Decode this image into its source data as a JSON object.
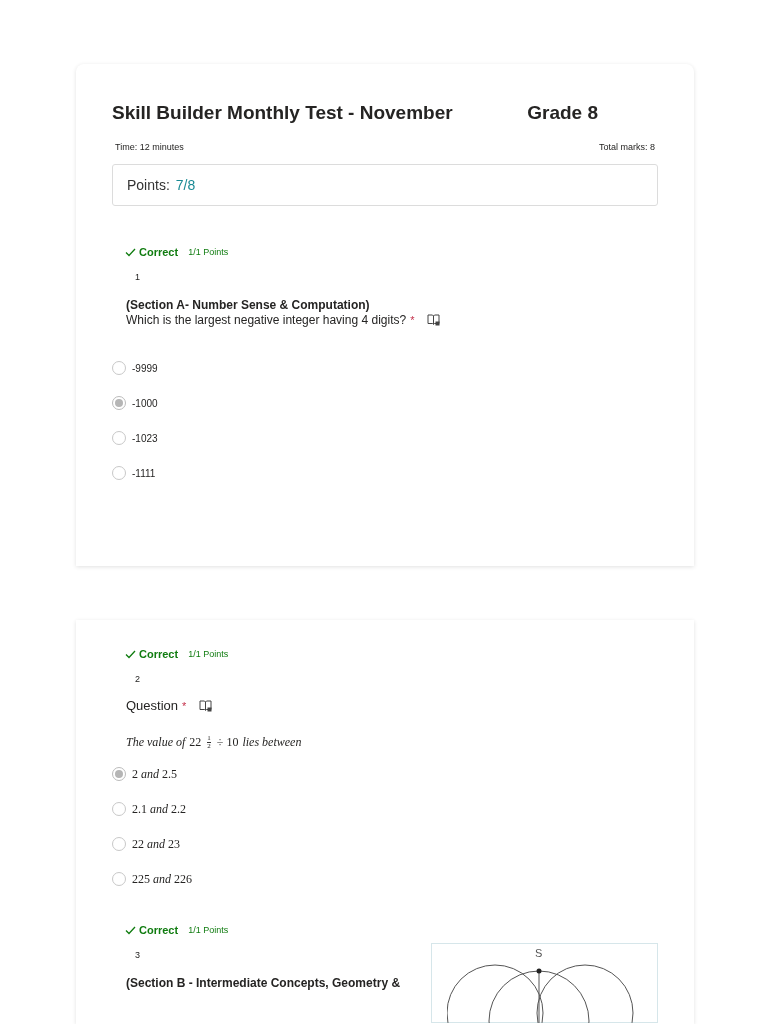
{
  "header": {
    "title": "Skill Builder Monthly Test - November",
    "grade": "Grade 8",
    "time": "Time: 12 minutes",
    "total_marks": "Total marks: 8",
    "points_label": "Points:",
    "points_value": "7/8"
  },
  "questions": [
    {
      "result": "Correct",
      "score": "1/1 Points",
      "number": "1",
      "kind": "text",
      "section": "(Section A- Number Sense & Computation)",
      "prompt": "Which is the largest negative integer having 4 digits?",
      "required": "*",
      "options": [
        {
          "label": "-9999",
          "selected": false
        },
        {
          "label": "-1000",
          "selected": true
        },
        {
          "label": "-1023",
          "selected": false
        },
        {
          "label": "-1111",
          "selected": false
        }
      ]
    },
    {
      "result": "Correct",
      "score": "1/1 Points",
      "number": "2",
      "kind": "math",
      "prompt": "Question",
      "required": "*",
      "math": {
        "prefix": "The value of",
        "whole": "22",
        "numerator": "1",
        "denominator": "2",
        "suffix": "÷ 10",
        "tail": "lies between"
      },
      "options": [
        {
          "label": "2 *and* 2.5",
          "selected": true
        },
        {
          "label": "2.1 *and* 2.2",
          "selected": false
        },
        {
          "label": "22 *and* 23",
          "selected": false
        },
        {
          "label": "225 *and* 226",
          "selected": false
        }
      ]
    },
    {
      "result": "Correct",
      "score": "1/1 Points",
      "number": "3",
      "kind": "figure",
      "section": "(Section B - Intermediate Concepts, Geometry &",
      "figure_label": "S"
    }
  ]
}
